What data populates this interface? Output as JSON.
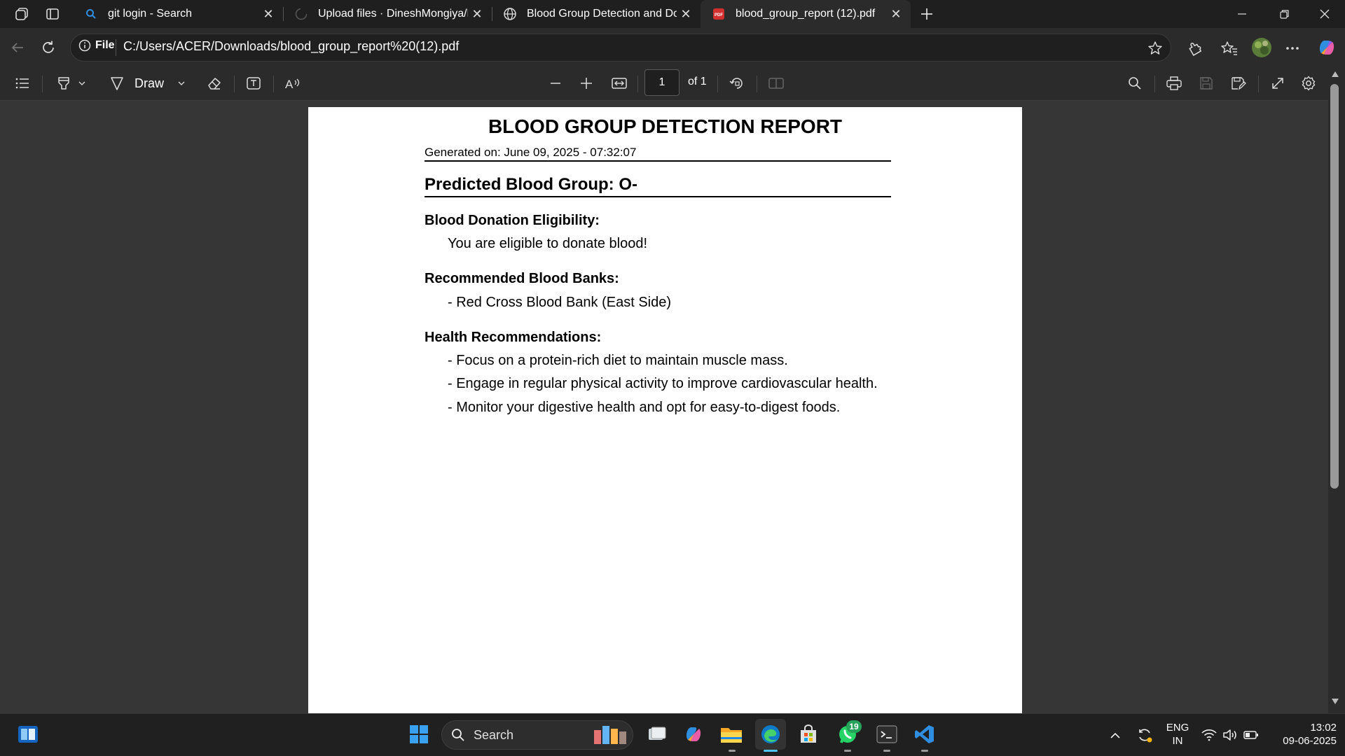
{
  "browser": {
    "tabs": [
      {
        "label": "git login - Search",
        "icon": "search-icon"
      },
      {
        "label": "Upload files · DineshMongiya/Blo",
        "icon": "github-icon"
      },
      {
        "label": "Blood Group Detection and Dona",
        "icon": "globe-icon"
      },
      {
        "label": "blood_group_report (12).pdf",
        "icon": "pdf-icon",
        "active": true
      }
    ],
    "address": {
      "badge": "File",
      "url": "C:/Users/ACER/Downloads/blood_group_report%20(12).pdf"
    }
  },
  "pdf_toolbar": {
    "draw_label": "Draw",
    "page_number": "1",
    "page_of": "of 1"
  },
  "report": {
    "title": "BLOOD GROUP DETECTION REPORT",
    "generated": "Generated on: June 09, 2025 - 07:32:07",
    "predicted": "Predicted Blood Group: O-",
    "eligibility_heading": "Blood Donation Eligibility:",
    "eligibility_text": "You are eligible to donate blood!",
    "banks_heading": "Recommended Blood Banks:",
    "banks": [
      "- Red Cross Blood Bank (East Side)"
    ],
    "health_heading": "Health Recommendations:",
    "health": [
      "- Focus on a protein-rich diet to maintain muscle mass.",
      "- Engage in regular physical activity to improve cardiovascular health.",
      "- Monitor your digestive health and opt for easy-to-digest foods."
    ]
  },
  "taskbar": {
    "search_label": "Search",
    "whatsapp_badge": "19",
    "lang_top": "ENG",
    "lang_bottom": "IN",
    "time": "13:02",
    "date": "09-06-2025"
  },
  "colors": {
    "accent": "#0078d4",
    "edge": "#2aa3e0",
    "pdf_red": "#d32f2f",
    "vscode": "#2f8ee0",
    "whatsapp": "#25d366"
  }
}
